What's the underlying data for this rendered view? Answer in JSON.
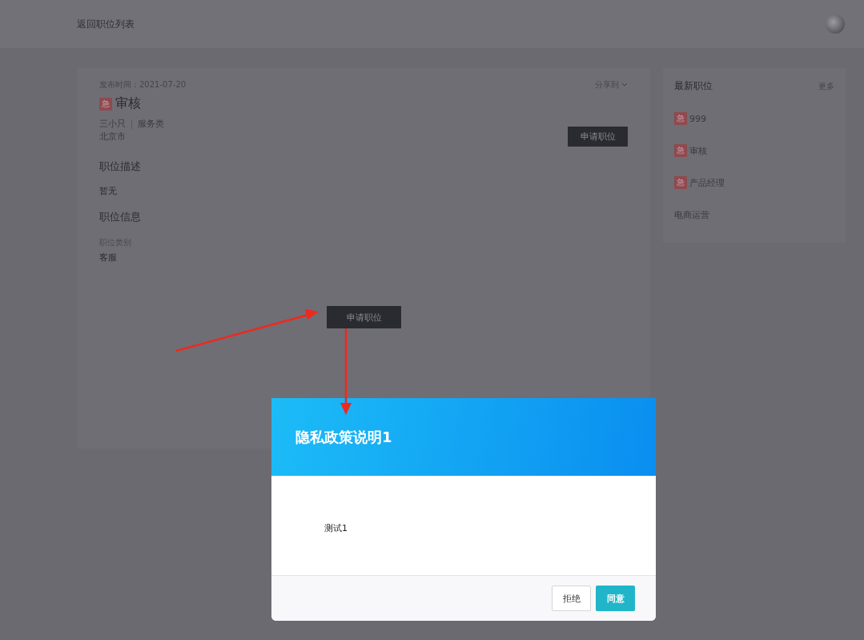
{
  "header": {
    "back_link": "返回职位列表"
  },
  "job": {
    "publish_time": "发布时间：2021-07-20",
    "share": "分享到",
    "badge": "急",
    "title": "审核",
    "company": "三小只",
    "category": "服务类",
    "city": "北京市",
    "apply_button": "申请职位",
    "sections": [
      {
        "heading": "职位描述",
        "text": "暂无"
      },
      {
        "heading": "职位信息",
        "label": "职位类别",
        "value": "客服"
      }
    ]
  },
  "sidebar": {
    "title": "最新职位",
    "more": "更多",
    "items": [
      {
        "badge": "急",
        "title": "999"
      },
      {
        "badge": "急",
        "title": "审核"
      },
      {
        "badge": "急",
        "title": "产品经理"
      },
      {
        "title": "电商运营"
      }
    ]
  },
  "floating_button": "申请职位",
  "modal": {
    "title": "隐私政策说明1",
    "body": "测试1",
    "buttons": [
      {
        "label": "拒绝",
        "kind": "default"
      },
      {
        "label": "同意",
        "kind": "primary"
      }
    ]
  }
}
